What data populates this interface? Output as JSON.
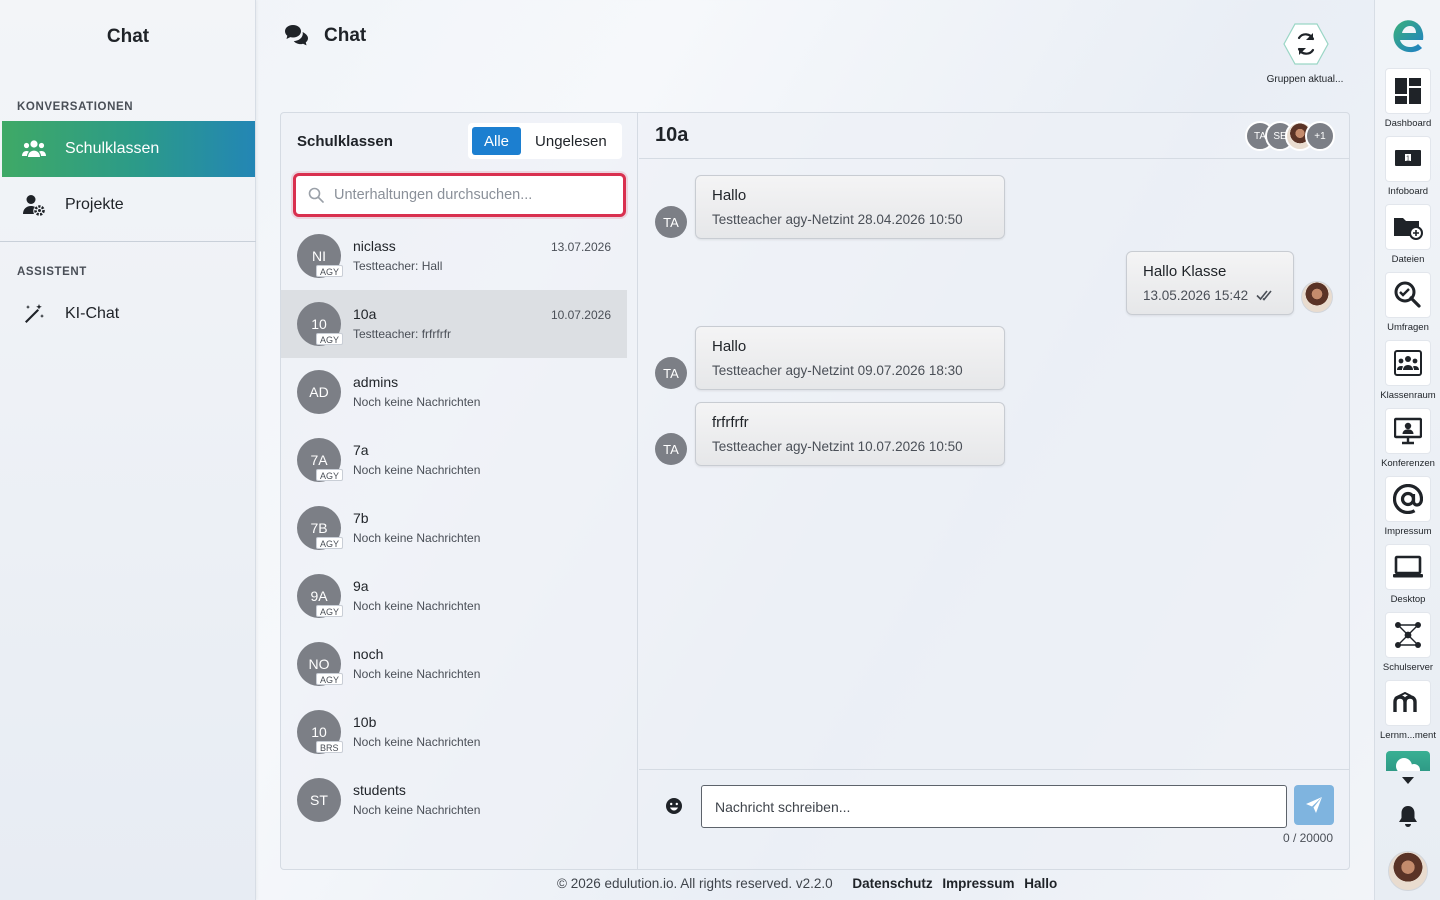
{
  "sidebar": {
    "title": "Chat",
    "section_conversations": "KONVERSATIONEN",
    "items": [
      {
        "label": "Schulklassen",
        "icon": "users-icon",
        "active": true
      },
      {
        "label": "Projekte",
        "icon": "user-gear-icon",
        "active": false
      }
    ],
    "section_assistant": "ASSISTENT",
    "assistant_items": [
      {
        "label": "KI-Chat",
        "icon": "magic-wand-icon"
      }
    ]
  },
  "header": {
    "title": "Chat",
    "icon": "chat-bubbles-icon",
    "refresh_label": "Gruppen aktual..."
  },
  "conversations": {
    "title": "Schulklassen",
    "filters": [
      {
        "label": "Alle",
        "active": true
      },
      {
        "label": "Ungelesen",
        "active": false
      }
    ],
    "search_placeholder": "Unterhaltungen durchsuchen...",
    "items": [
      {
        "initials": "NI",
        "badge": "AGY",
        "name": "niclass",
        "subtitle": "Testteacher: Hall",
        "date": "13.07.2026",
        "selected": false
      },
      {
        "initials": "10",
        "badge": "AGY",
        "name": "10a",
        "subtitle": "Testteacher: frfrfrfr",
        "date": "10.07.2026",
        "selected": true
      },
      {
        "initials": "AD",
        "badge": "",
        "name": "admins",
        "subtitle": "Noch keine Nachrichten",
        "date": "",
        "selected": false
      },
      {
        "initials": "7A",
        "badge": "AGY",
        "name": "7a",
        "subtitle": "Noch keine Nachrichten",
        "date": "",
        "selected": false
      },
      {
        "initials": "7B",
        "badge": "AGY",
        "name": "7b",
        "subtitle": "Noch keine Nachrichten",
        "date": "",
        "selected": false
      },
      {
        "initials": "9A",
        "badge": "AGY",
        "name": "9a",
        "subtitle": "Noch keine Nachrichten",
        "date": "",
        "selected": false
      },
      {
        "initials": "NO",
        "badge": "AGY",
        "name": "noch",
        "subtitle": "Noch keine Nachrichten",
        "date": "",
        "selected": false
      },
      {
        "initials": "10",
        "badge": "BRS",
        "name": "10b",
        "subtitle": "Noch keine Nachrichten",
        "date": "",
        "selected": false
      },
      {
        "initials": "ST",
        "badge": "",
        "name": "students",
        "subtitle": "Noch keine Nachrichten",
        "date": "",
        "selected": false
      }
    ]
  },
  "chat": {
    "title": "10a",
    "members": [
      {
        "initials": "TA"
      },
      {
        "initials": "SE"
      },
      {
        "initials": ""
      },
      {
        "initials": "+1"
      }
    ],
    "messages": [
      {
        "text": "Hallo",
        "meta": "Testteacher agy-Netzint  28.04.2026 10:50",
        "avatar": "TA",
        "own": false
      },
      {
        "text": "Hallo Klasse",
        "meta": "13.05.2026 15:42",
        "avatar": "",
        "own": true,
        "status": "read-check-icon"
      },
      {
        "text": "Hallo",
        "meta": "Testteacher agy-Netzint  09.07.2026 18:30",
        "avatar": "TA",
        "own": false
      },
      {
        "text": "frfrfrfr",
        "meta": "Testteacher agy-Netzint  10.07.2026 10:50",
        "avatar": "TA",
        "own": false
      }
    ],
    "input_placeholder": "Nachricht schreiben...",
    "char_count": "0 / 20000"
  },
  "footer": {
    "copyright": "© 2026 edulution.io. All rights reserved. v2.2.0",
    "links": [
      "Datenschutz",
      "Impressum",
      "Hallo"
    ]
  },
  "dock": {
    "items": [
      {
        "label": "Dashboard",
        "icon": "dashboard-icon"
      },
      {
        "label": "Infoboard",
        "icon": "infoboard-icon"
      },
      {
        "label": "Dateien",
        "icon": "folder-icon"
      },
      {
        "label": "Umfragen",
        "icon": "survey-icon"
      },
      {
        "label": "Klassenraum",
        "icon": "classroom-icon"
      },
      {
        "label": "Konferenzen",
        "icon": "conference-icon"
      },
      {
        "label": "Impressum",
        "icon": "at-icon"
      },
      {
        "label": "Desktop",
        "icon": "laptop-icon"
      },
      {
        "label": "Schulserver",
        "icon": "network-icon"
      },
      {
        "label": "Lernm...ment",
        "icon": "moodle-icon"
      }
    ]
  },
  "colors": {
    "accent_blue": "#1c7fd0",
    "active_gradient_start": "#3fa966",
    "active_gradient_end": "#2386b5",
    "search_focus": "#d9304f",
    "send_button": "#7fb4df"
  }
}
